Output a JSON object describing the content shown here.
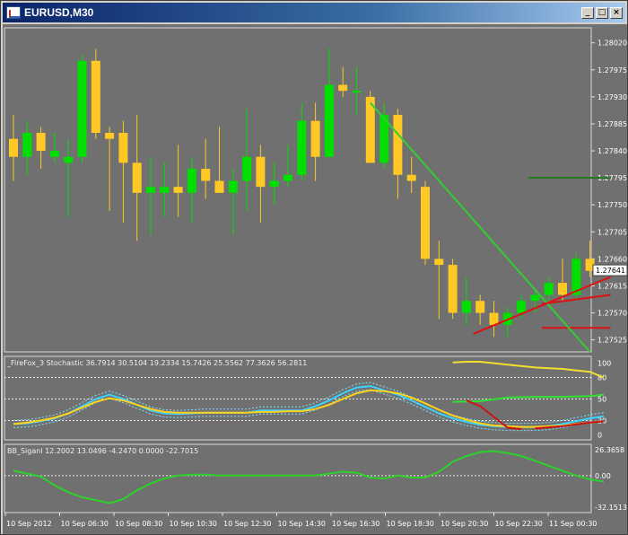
{
  "window": {
    "title": "EURUSD,M30",
    "buttons": {
      "minimize": "_",
      "maximize": "□",
      "close": "×"
    }
  },
  "main": {
    "price_labels": [
      "1.28020",
      "1.27975",
      "1.27930",
      "1.27885",
      "1.27840",
      "1.27795",
      "1.27750",
      "1.27705",
      "1.27660",
      "1.27615",
      "1.27570",
      "1.27525"
    ],
    "current_price": "1.27641",
    "candles": [
      {
        "o": 1.2786,
        "h": 1.279,
        "l": 1.2779,
        "c": 1.2783
      },
      {
        "o": 1.2783,
        "h": 1.2789,
        "l": 1.278,
        "c": 1.2787
      },
      {
        "o": 1.2787,
        "h": 1.2788,
        "l": 1.2781,
        "c": 1.2784
      },
      {
        "o": 1.2783,
        "h": 1.2787,
        "l": 1.2782,
        "c": 1.2784
      },
      {
        "o": 1.2782,
        "h": 1.2786,
        "l": 1.2773,
        "c": 1.2783
      },
      {
        "o": 1.2783,
        "h": 1.28,
        "l": 1.2782,
        "c": 1.2799
      },
      {
        "o": 1.2799,
        "h": 1.2801,
        "l": 1.2786,
        "c": 1.2787
      },
      {
        "o": 1.2787,
        "h": 1.2788,
        "l": 1.2774,
        "c": 1.2786
      },
      {
        "o": 1.2787,
        "h": 1.2789,
        "l": 1.2772,
        "c": 1.2782
      },
      {
        "o": 1.2782,
        "h": 1.279,
        "l": 1.2769,
        "c": 1.2777
      },
      {
        "o": 1.2777,
        "h": 1.2783,
        "l": 1.277,
        "c": 1.2778
      },
      {
        "o": 1.2777,
        "h": 1.2782,
        "l": 1.2773,
        "c": 1.2778
      },
      {
        "o": 1.2778,
        "h": 1.2785,
        "l": 1.2773,
        "c": 1.2777
      },
      {
        "o": 1.2777,
        "h": 1.2783,
        "l": 1.2772,
        "c": 1.2781
      },
      {
        "o": 1.2781,
        "h": 1.2786,
        "l": 1.2776,
        "c": 1.2779
      },
      {
        "o": 1.2779,
        "h": 1.2788,
        "l": 1.2777,
        "c": 1.2777
      },
      {
        "o": 1.2777,
        "h": 1.2781,
        "l": 1.277,
        "c": 1.2779
      },
      {
        "o": 1.2779,
        "h": 1.2791,
        "l": 1.2774,
        "c": 1.2783
      },
      {
        "o": 1.2783,
        "h": 1.2785,
        "l": 1.2772,
        "c": 1.2778
      },
      {
        "o": 1.2778,
        "h": 1.2782,
        "l": 1.2775,
        "c": 1.2779
      },
      {
        "o": 1.2779,
        "h": 1.2785,
        "l": 1.2778,
        "c": 1.278
      },
      {
        "o": 1.278,
        "h": 1.2792,
        "l": 1.2779,
        "c": 1.2789
      },
      {
        "o": 1.2789,
        "h": 1.2792,
        "l": 1.2779,
        "c": 1.2783
      },
      {
        "o": 1.2783,
        "h": 1.2801,
        "l": 1.2783,
        "c": 1.2795
      },
      {
        "o": 1.2795,
        "h": 1.2798,
        "l": 1.2793,
        "c": 1.2794
      },
      {
        "o": 1.2794,
        "h": 1.2798,
        "l": 1.279,
        "c": 1.2794
      },
      {
        "o": 1.2793,
        "h": 1.2794,
        "l": 1.2782,
        "c": 1.2782
      },
      {
        "o": 1.2782,
        "h": 1.2792,
        "l": 1.2781,
        "c": 1.279
      },
      {
        "o": 1.279,
        "h": 1.2791,
        "l": 1.2776,
        "c": 1.278
      },
      {
        "o": 1.278,
        "h": 1.2783,
        "l": 1.2777,
        "c": 1.2779
      },
      {
        "o": 1.2778,
        "h": 1.2779,
        "l": 1.2765,
        "c": 1.2766
      },
      {
        "o": 1.2766,
        "h": 1.2769,
        "l": 1.2756,
        "c": 1.2765
      },
      {
        "o": 1.2765,
        "h": 1.2766,
        "l": 1.2756,
        "c": 1.2757
      },
      {
        "o": 1.2757,
        "h": 1.2763,
        "l": 1.2755,
        "c": 1.2759
      },
      {
        "o": 1.2759,
        "h": 1.276,
        "l": 1.2755,
        "c": 1.2757
      },
      {
        "o": 1.2757,
        "h": 1.2759,
        "l": 1.2753,
        "c": 1.2755
      },
      {
        "o": 1.2755,
        "h": 1.2758,
        "l": 1.2753,
        "c": 1.2757
      },
      {
        "o": 1.2757,
        "h": 1.276,
        "l": 1.2756,
        "c": 1.2759
      },
      {
        "o": 1.2759,
        "h": 1.2761,
        "l": 1.2757,
        "c": 1.276
      },
      {
        "o": 1.276,
        "h": 1.2763,
        "l": 1.2758,
        "c": 1.2762
      },
      {
        "o": 1.2762,
        "h": 1.2766,
        "l": 1.2759,
        "c": 1.276
      },
      {
        "o": 1.276,
        "h": 1.2767,
        "l": 1.2759,
        "c": 1.2766
      },
      {
        "o": 1.2766,
        "h": 1.2769,
        "l": 1.2763,
        "c": 1.2764
      }
    ],
    "trendlines": [
      {
        "from": [
          26,
          1.2792
        ],
        "to": [
          42,
          1.275
        ],
        "color": "#32cd32"
      },
      {
        "from": [
          33.5,
          1.27535
        ],
        "to": [
          43.5,
          1.2763
        ],
        "color": "#dd1111"
      },
      {
        "from": [
          38.5,
          1.27585
        ],
        "to": [
          43.5,
          1.276
        ],
        "color": "#dd1111"
      }
    ],
    "levels": [
      {
        "value": 1.27795,
        "from": 37.5,
        "to": 43.5,
        "color": "#207a20"
      },
      {
        "value": 1.27545,
        "from": 38.5,
        "to": 43.5,
        "color": "#dd1111"
      }
    ]
  },
  "stoch": {
    "label": "_FireFox_3 Stochastic 36.7914 30.5104 19.2334 15.7426 25.5562 77.3626 56.2811",
    "levels": [
      "100",
      "80",
      "50",
      "20",
      "0"
    ],
    "yellow": [
      15,
      17,
      20,
      24,
      30,
      38,
      46,
      51,
      48,
      42,
      36,
      32,
      31,
      31,
      31,
      31,
      31,
      31,
      32,
      32,
      33,
      33,
      36,
      42,
      50,
      58,
      62,
      61,
      58,
      52,
      44,
      35,
      27,
      21,
      16,
      13,
      12,
      11,
      11,
      12,
      13,
      15,
      17,
      19
    ],
    "cyan": [
      15,
      16,
      19,
      23,
      30,
      40,
      50,
      56,
      50,
      42,
      34,
      30,
      29,
      30,
      31,
      31,
      31,
      31,
      34,
      34,
      34,
      34,
      40,
      48,
      58,
      66,
      68,
      62,
      56,
      48,
      39,
      30,
      23,
      18,
      14,
      12,
      11,
      11,
      11,
      12,
      15,
      19,
      23,
      26
    ],
    "top_yellow": [
      [
        32,
        101
      ],
      [
        33,
        102
      ],
      [
        34,
        102
      ],
      [
        36,
        98
      ],
      [
        38,
        94
      ],
      [
        40,
        92
      ],
      [
        42,
        88
      ],
      [
        43,
        80
      ]
    ],
    "mid_green": [
      [
        32,
        46
      ],
      [
        34,
        47
      ],
      [
        36,
        52
      ],
      [
        38,
        53
      ],
      [
        40,
        53
      ],
      [
        42,
        54
      ],
      [
        43,
        56
      ]
    ],
    "red_line": [
      [
        33,
        48
      ],
      [
        34,
        40
      ],
      [
        35,
        25
      ],
      [
        36,
        10
      ],
      [
        37,
        8
      ]
    ],
    "red_line2": [
      [
        38,
        9
      ],
      [
        40,
        12
      ],
      [
        42,
        17
      ],
      [
        43,
        19
      ]
    ]
  },
  "bbsig": {
    "label": "BB_Siganl 12.2002 13.0496 -4.2470 0.0000 -22.7015",
    "ticks": [
      "26.3658",
      "0.00",
      "-32.1513"
    ],
    "values": [
      5,
      2,
      -1,
      -10,
      -17,
      -22,
      -25,
      -28,
      -24,
      -15,
      -8,
      -3,
      0,
      1,
      1,
      0,
      0,
      0,
      0,
      0,
      0,
      0,
      0,
      2,
      4,
      3,
      -2,
      -3,
      0,
      -2,
      -2,
      4,
      14,
      20,
      24,
      25,
      23,
      20,
      15,
      10,
      5,
      0,
      -4,
      -6
    ]
  },
  "time_labels": [
    "10 Sep 2012",
    "10 Sep 06:30",
    "10 Sep 08:30",
    "10 Sep 10:30",
    "10 Sep 12:30",
    "10 Sep 14:30",
    "10 Sep 16:30",
    "10 Sep 18:30",
    "10 Sep 20:30",
    "10 Sep 22:30",
    "11 Sep 00:30"
  ],
  "colors": {
    "background": "#707070",
    "bull": "#00e000",
    "bear": "#ffc825",
    "grid": "#a0a0a0",
    "axis_text": "#ffffff",
    "stoch_yellow": "#ffd21a",
    "stoch_cyan": "#3cd2ff",
    "bbsig": "#2ad22a"
  }
}
